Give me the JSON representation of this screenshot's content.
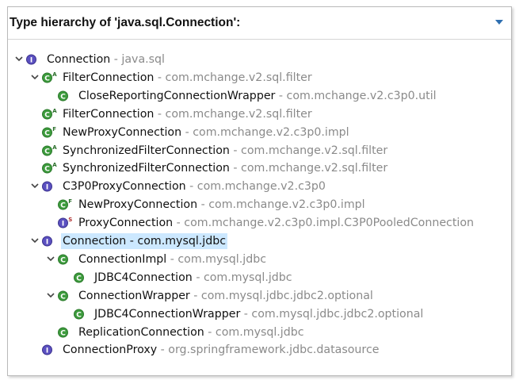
{
  "header": {
    "title": "Type hierarchy of 'java.sql.Connection':"
  },
  "colors": {
    "class_green": "#3d9b3d",
    "interface_purple": "#5b50c0",
    "selection": "#cce8ff"
  },
  "tree": [
    {
      "name": "Connection",
      "pkg": " - java.sql",
      "level": 0,
      "icon": "interface",
      "expander": "expanded"
    },
    {
      "name": "FilterConnection",
      "pkg": " - com.mchange.v2.sql.filter",
      "level": 1,
      "icon": "class-abstract",
      "expander": "expanded"
    },
    {
      "name": "CloseReportingConnectionWrapper",
      "pkg": " - com.mchange.v2.c3p0.util",
      "level": 2,
      "icon": "class",
      "expander": "none"
    },
    {
      "name": "FilterConnection",
      "pkg": " - com.mchange.v2.sql.filter",
      "level": 1,
      "icon": "class-abstract",
      "expander": "none"
    },
    {
      "name": "NewProxyConnection",
      "pkg": " - com.mchange.v2.c3p0.impl",
      "level": 1,
      "icon": "class-final",
      "expander": "none"
    },
    {
      "name": "SynchronizedFilterConnection",
      "pkg": " - com.mchange.v2.sql.filter",
      "level": 1,
      "icon": "class-abstract",
      "expander": "none"
    },
    {
      "name": "SynchronizedFilterConnection",
      "pkg": " - com.mchange.v2.sql.filter",
      "level": 1,
      "icon": "class-abstract",
      "expander": "none"
    },
    {
      "name": "C3P0ProxyConnection",
      "pkg": " - com.mchange.v2.c3p0",
      "level": 1,
      "icon": "interface",
      "expander": "expanded"
    },
    {
      "name": "NewProxyConnection",
      "pkg": " - com.mchange.v2.c3p0.impl",
      "level": 2,
      "icon": "class-final",
      "expander": "none"
    },
    {
      "name": "ProxyConnection",
      "pkg": " - com.mchange.v2.c3p0.impl.C3P0PooledConnection",
      "level": 2,
      "icon": "interface-static",
      "expander": "none"
    },
    {
      "name": "Connection",
      "pkg": " - com.mysql.jdbc",
      "level": 1,
      "icon": "interface",
      "expander": "expanded",
      "selected": true
    },
    {
      "name": "ConnectionImpl",
      "pkg": " - com.mysql.jdbc",
      "level": 2,
      "icon": "class",
      "expander": "expanded"
    },
    {
      "name": "JDBC4Connection",
      "pkg": " - com.mysql.jdbc",
      "level": 3,
      "icon": "class",
      "expander": "none"
    },
    {
      "name": "ConnectionWrapper",
      "pkg": " - com.mysql.jdbc.jdbc2.optional",
      "level": 2,
      "icon": "class",
      "expander": "expanded"
    },
    {
      "name": "JDBC4ConnectionWrapper",
      "pkg": " - com.mysql.jdbc.jdbc2.optional",
      "level": 3,
      "icon": "class",
      "expander": "none"
    },
    {
      "name": "ReplicationConnection",
      "pkg": " - com.mysql.jdbc",
      "level": 2,
      "icon": "class",
      "expander": "none"
    },
    {
      "name": "ConnectionProxy",
      "pkg": " - org.springframework.jdbc.datasource",
      "level": 1,
      "icon": "interface",
      "expander": "none"
    }
  ]
}
